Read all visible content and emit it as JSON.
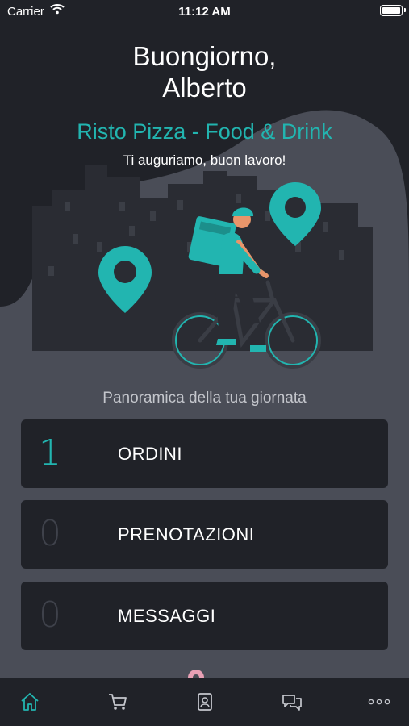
{
  "status_bar": {
    "carrier": "Carrier",
    "time": "11:12 AM"
  },
  "header": {
    "greeting_line1": "Buongiorno,",
    "greeting_line2": "Alberto",
    "restaurant_name": "Risto Pizza - Food & Drink",
    "subtitle": "Ti auguriamo, buon lavoro!"
  },
  "overview": {
    "title": "Panoramica della tua giornata",
    "cards": [
      {
        "count": "1",
        "label": "ORDINI",
        "active": true
      },
      {
        "count": "0",
        "label": "PRENOTAZIONI",
        "active": false
      },
      {
        "count": "0",
        "label": "MESSAGGI",
        "active": false
      }
    ]
  },
  "tabbar": {
    "items": [
      {
        "icon": "home-icon",
        "active": true
      },
      {
        "icon": "cart-icon",
        "active": false
      },
      {
        "icon": "contacts-book-icon",
        "active": false
      },
      {
        "icon": "chat-bubbles-icon",
        "active": false
      },
      {
        "icon": "more-icon",
        "active": false
      }
    ]
  },
  "colors": {
    "accent": "#22b5b0",
    "dark_bg": "#202228",
    "mid_bg": "#4a4d57",
    "text_muted": "#c4c6cc"
  }
}
